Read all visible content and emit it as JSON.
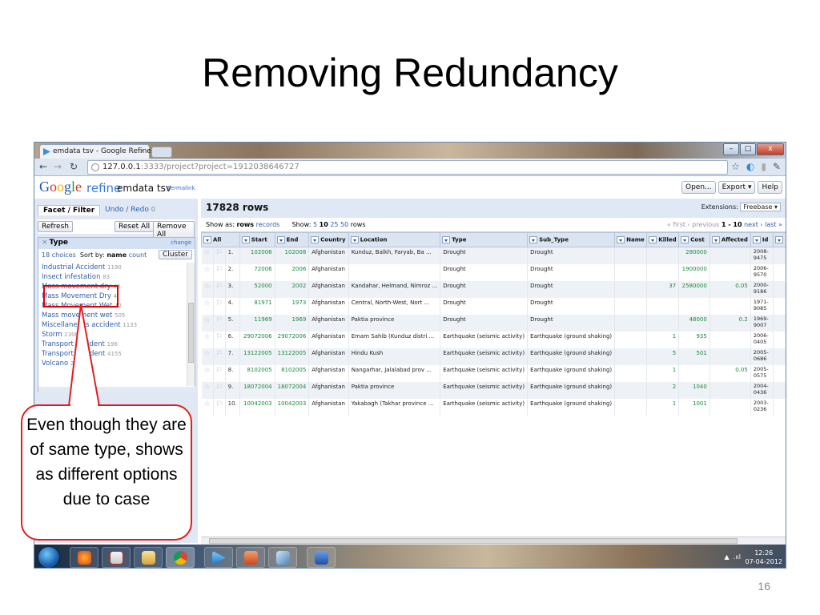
{
  "slide": {
    "title": "Removing Redundancy",
    "page_number": "16",
    "callout_text": "Even though they are of same type, shows as different options due to case",
    "annotation_color": "#e00000"
  },
  "browser": {
    "tab_title": "emdata tsv - Google Refine",
    "tab_close": "×",
    "url_host": "127.0.0.1",
    "url_rest": ":3333/project?project=1912038646727",
    "win_minimize": "–",
    "win_maximize": "□",
    "win_close": "x"
  },
  "app": {
    "logo_google": [
      "G",
      "o",
      "o",
      "g",
      "l",
      "e"
    ],
    "logo_refine": "refine",
    "project_name": "emdata tsv",
    "permalink": "Permalink",
    "buttons": [
      "Open...",
      "Export ▾",
      "Help"
    ]
  },
  "left_panel": {
    "tab_facet": "Facet / Filter",
    "tab_undo": "Undo / Redo",
    "tab_undo_count": "0",
    "refresh": "Refresh",
    "reset_all": "Reset All",
    "remove_all": "Remove All",
    "facet": {
      "close": "×",
      "name": "Type",
      "change": "change",
      "choices_count": "18 choices",
      "sort_by": "Sort by:",
      "sort_name": "name",
      "sort_count": "count",
      "cluster": "Cluster",
      "choices": [
        {
          "label": "Industrial Accident",
          "count": "1190"
        },
        {
          "label": "Insect infestation",
          "count": "83"
        },
        {
          "label": "Mass movement dry",
          "count": "48"
        },
        {
          "label": "Mass Movement Dry",
          "count": "4"
        },
        {
          "label": "Mass Movement Wet",
          "count": "12"
        },
        {
          "label": "Mass movement wet",
          "count": "505"
        },
        {
          "label": "Miscellaneous accident",
          "count": "1133"
        },
        {
          "label": "Storm",
          "count": "2306"
        },
        {
          "label": "Transport accident",
          "count": "196"
        },
        {
          "label": "Transport Accident",
          "count": "4155"
        },
        {
          "label": "Volcano",
          "count": "211"
        }
      ]
    }
  },
  "right_panel": {
    "row_count": "17828 rows",
    "extensions_label": "Extensions:",
    "extensions_value": "Freebase ▾",
    "show_as": "Show as:",
    "show_rows": "rows",
    "show_records": "records",
    "show_label": "Show:",
    "page_sizes": [
      "5",
      "10",
      "25",
      "50"
    ],
    "page_size_selected": "10",
    "rows_word": "rows",
    "pager_first": "« first",
    "pager_prev": "‹ previous",
    "pager_range": "1 - 10",
    "pager_next": "next ›",
    "pager_last": "last »",
    "columns": [
      "All",
      "Start",
      "End",
      "Country",
      "Location",
      "Type",
      "Sub_Type",
      "Name",
      "Killed",
      "Cost",
      "Affected",
      "Id"
    ],
    "rows": [
      {
        "idx": "1.",
        "start": "102008",
        "end": "102008",
        "country": "Afghanistan",
        "location": "Kunduz, Balkh, Faryab, Ba ...",
        "type": "Drought",
        "sub_type": "Drought",
        "name": "",
        "killed": "",
        "cost": "280000",
        "affected": "",
        "id1": "2008-",
        "id2": "9475"
      },
      {
        "idx": "2.",
        "start": "72006",
        "end": "2006",
        "country": "Afghanistan",
        "location": "",
        "type": "Drought",
        "sub_type": "Drought",
        "name": "",
        "killed": "",
        "cost": "1900000",
        "affected": "",
        "id1": "2006-",
        "id2": "9570"
      },
      {
        "idx": "3.",
        "start": "52000",
        "end": "2002",
        "country": "Afghanistan",
        "location": "Kandahar, Helmand, Nimroz ...",
        "type": "Drought",
        "sub_type": "Drought",
        "name": "",
        "killed": "37",
        "cost": "2580000",
        "affected": "0.05",
        "id1": "2000-",
        "id2": "9186"
      },
      {
        "idx": "4.",
        "start": "81971",
        "end": "1973",
        "country": "Afghanistan",
        "location": "Central, North-West, Nort ...",
        "type": "Drought",
        "sub_type": "Drought",
        "name": "",
        "killed": "",
        "cost": "",
        "affected": "",
        "id1": "1971-",
        "id2": "9085"
      },
      {
        "idx": "5.",
        "start": "11969",
        "end": "1969",
        "country": "Afghanistan",
        "location": "Paktia province",
        "type": "Drought",
        "sub_type": "Drought",
        "name": "",
        "killed": "",
        "cost": "48000",
        "affected": "0.2",
        "id1": "1969-",
        "id2": "9007"
      },
      {
        "idx": "6.",
        "start": "29072006",
        "end": "29072006",
        "country": "Afghanistan",
        "location": "Emam Sahib (Kunduz distri ...",
        "type": "Earthquake (seismic activity)",
        "sub_type": "Earthquake (ground shaking)",
        "name": "",
        "killed": "1",
        "cost": "935",
        "affected": "",
        "id1": "2006-",
        "id2": "0405"
      },
      {
        "idx": "7.",
        "start": "13122005",
        "end": "13122005",
        "country": "Afghanistan",
        "location": "Hindu Kush",
        "type": "Earthquake (seismic activity)",
        "sub_type": "Earthquake (ground shaking)",
        "name": "",
        "killed": "5",
        "cost": "501",
        "affected": "",
        "id1": "2005-",
        "id2": "0686"
      },
      {
        "idx": "8.",
        "start": "8102005",
        "end": "8102005",
        "country": "Afghanistan",
        "location": "Nangarhar, Jalalabad prov ...",
        "type": "Earthquake (seismic activity)",
        "sub_type": "Earthquake (ground shaking)",
        "name": "",
        "killed": "1",
        "cost": "",
        "affected": "0.05",
        "id1": "2005-",
        "id2": "0575"
      },
      {
        "idx": "9.",
        "start": "18072004",
        "end": "18072004",
        "country": "Afghanistan",
        "location": "Paktia province",
        "type": "Earthquake (seismic activity)",
        "sub_type": "Earthquake (ground shaking)",
        "name": "",
        "killed": "2",
        "cost": "1040",
        "affected": "",
        "id1": "2004-",
        "id2": "0436"
      },
      {
        "idx": "10.",
        "start": "10042003",
        "end": "10042003",
        "country": "Afghanistan",
        "location": "Yakabagh (Takhar province ...",
        "type": "Earthquake (seismic activity)",
        "sub_type": "Earthquake (ground shaking)",
        "name": "",
        "killed": "1",
        "cost": "1001",
        "affected": "",
        "id1": "2003-",
        "id2": "0236"
      }
    ]
  },
  "taskbar": {
    "time": "12:26",
    "date": "07-04-2012"
  }
}
